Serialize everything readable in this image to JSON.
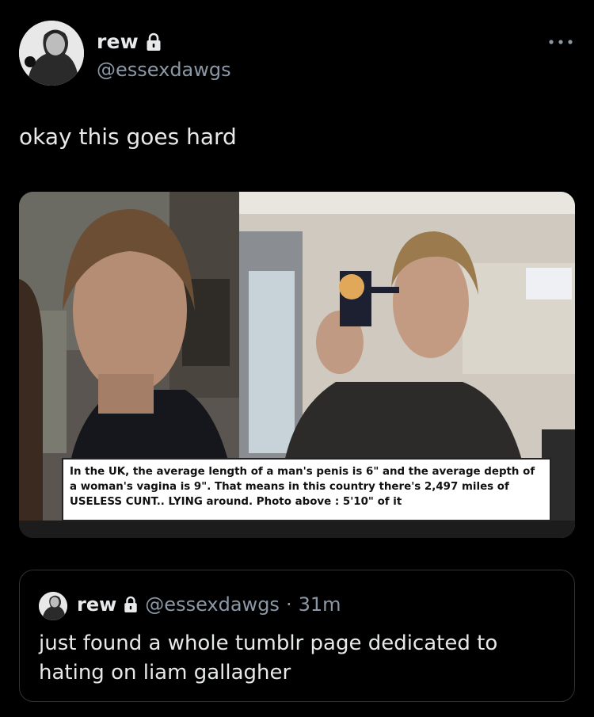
{
  "tweet": {
    "author": {
      "display_name": "rew",
      "handle": "@essexdawgs",
      "verified_icon": "lock-icon"
    },
    "text": "okay this goes hard",
    "more_icon": "more-horizontal-icon",
    "media": {
      "caption": "In the UK, the average length of a man's penis is 6\" and the average depth of a woman's vagina is 9\". That means in this country there's 2,497 miles of USELESS CUNT.. LYING around. Photo above : 5'10\" of it"
    },
    "quote": {
      "display_name": "rew",
      "handle": "@essexdawgs",
      "separator": "·",
      "time": "31m",
      "text": "just found a whole tumblr page dedicated to hating on liam gallagher"
    }
  },
  "colors": {
    "background": "#000000",
    "text": "#e7e9ea",
    "secondary": "#8b98a5",
    "border": "#2f3336"
  }
}
